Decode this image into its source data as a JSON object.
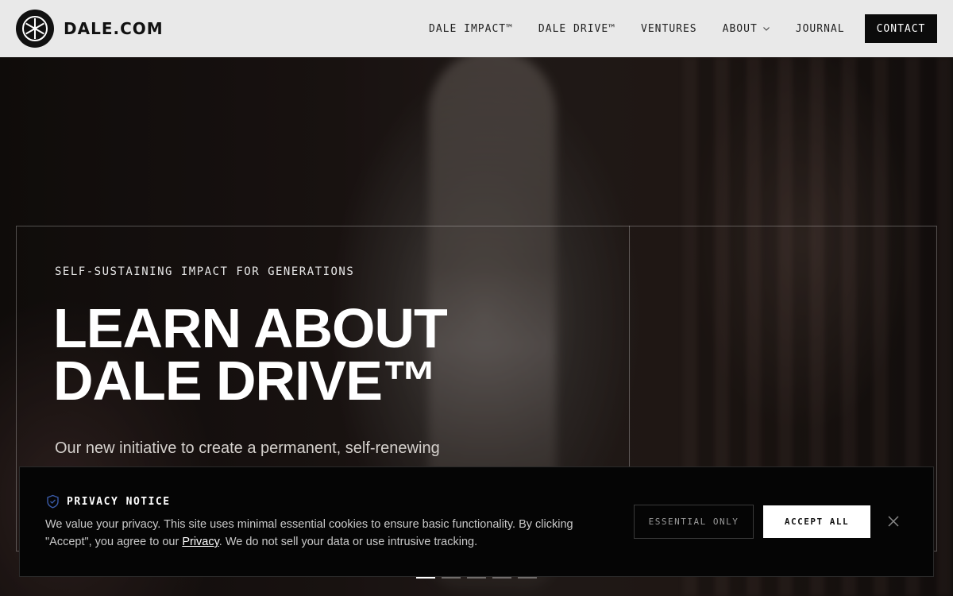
{
  "header": {
    "logo_text": "DALE.COM",
    "logo_icon": "wheel-logo-icon",
    "nav": [
      {
        "label": "DALE IMPACT™"
      },
      {
        "label": "DALE DRIVE™"
      },
      {
        "label": "VENTURES"
      },
      {
        "label": "ABOUT",
        "has_dropdown": true
      },
      {
        "label": "JOURNAL"
      }
    ],
    "contact_label": "CONTACT"
  },
  "hero": {
    "eyebrow": "SELF-SUSTAINING IMPACT FOR GENERATIONS",
    "headline_line1": "LEARN ABOUT",
    "headline_line2": "DALE DRIVE™",
    "subtext": "Our new initiative to create a permanent, self-renewing",
    "slides": {
      "count": 5,
      "active_index": 0
    }
  },
  "privacy": {
    "title": "PRIVACY NOTICE",
    "icon": "shield-icon",
    "text_before_link": "We value your privacy. This site uses minimal essential cookies to ensure basic functionality. By clicking \"Accept\", you agree to our ",
    "link_label": "Privacy",
    "text_after_link": ". We do not sell your data or use intrusive tracking.",
    "essential_label": "ESSENTIAL ONLY",
    "accept_label": "ACCEPT ALL",
    "close_icon": "close-icon"
  },
  "colors": {
    "header_bg": "#e9e9e9",
    "contact_bg": "#0b0b0b",
    "privacy_bg": "#050505",
    "shield_accent": "#3a5ba8"
  }
}
